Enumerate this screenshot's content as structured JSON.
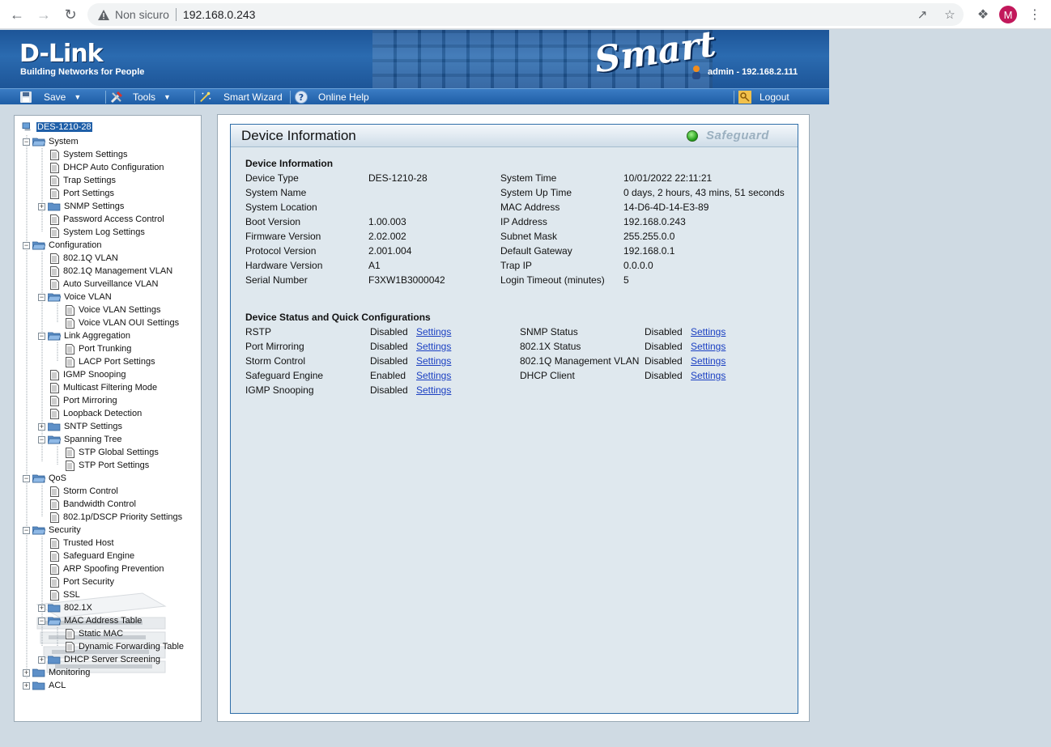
{
  "browser": {
    "security_label": "Non sicuro",
    "url": "192.168.0.243",
    "profile_initial": "M"
  },
  "banner": {
    "logo": "D-Link",
    "tagline": "Building Networks for People",
    "product": "Smart",
    "user": "admin - 192.168.2.111"
  },
  "menubar": {
    "save": "Save",
    "tools": "Tools",
    "wizard": "Smart Wizard",
    "help": "Online Help",
    "logout": "Logout"
  },
  "tree": {
    "root": "DES-1210-28",
    "system": "System",
    "system_settings": "System Settings",
    "dhcp_auto": "DHCP Auto Configuration",
    "trap": "Trap Settings",
    "port_settings": "Port Settings",
    "snmp": "SNMP Settings",
    "password": "Password Access Control",
    "syslog": "System Log Settings",
    "configuration": "Configuration",
    "vlan": "802.1Q VLAN",
    "mgmt_vlan": "802.1Q Management VLAN",
    "auto_surv": "Auto Surveillance VLAN",
    "voice_vlan": "Voice VLAN",
    "voice_vlan_settings": "Voice VLAN Settings",
    "voice_oui": "Voice VLAN OUI Settings",
    "link_agg": "Link Aggregation",
    "port_trunking": "Port Trunking",
    "lacp": "LACP Port Settings",
    "igmp": "IGMP Snooping",
    "multicast": "Multicast Filtering Mode",
    "port_mirroring": "Port Mirroring",
    "loopback": "Loopback Detection",
    "sntp": "SNTP Settings",
    "spanning": "Spanning Tree",
    "stp_global": "STP Global Settings",
    "stp_port": "STP Port Settings",
    "qos": "QoS",
    "storm": "Storm Control",
    "bandwidth": "Bandwidth Control",
    "priority": "802.1p/DSCP Priority Settings",
    "security": "Security",
    "trusted": "Trusted Host",
    "safeguard": "Safeguard Engine",
    "arp": "ARP Spoofing Prevention",
    "port_security": "Port Security",
    "ssl": "SSL",
    "dot1x": "802.1X",
    "mac_table": "MAC Address Table",
    "static_mac": "Static MAC",
    "dynamic_fwd": "Dynamic Forwarding Table",
    "dhcp_screen": "DHCP Server Screening",
    "monitoring": "Monitoring",
    "acl": "ACL"
  },
  "panel": {
    "title": "Device Information",
    "safeguard": "Safeguard",
    "info_title": "Device Information",
    "info_left": [
      {
        "label": "Device Type",
        "value": "DES-1210-28"
      },
      {
        "label": "System Name",
        "value": ""
      },
      {
        "label": "System Location",
        "value": ""
      },
      {
        "label": "Boot Version",
        "value": "1.00.003"
      },
      {
        "label": "Firmware Version",
        "value": "2.02.002"
      },
      {
        "label": "Protocol Version",
        "value": "2.001.004"
      },
      {
        "label": "Hardware Version",
        "value": "A1"
      },
      {
        "label": "Serial Number",
        "value": "F3XW1B3000042"
      }
    ],
    "info_right": [
      {
        "label": "System Time",
        "value": "10/01/2022 22:11:21"
      },
      {
        "label": "System Up Time",
        "value": "0 days, 2 hours, 43 mins, 51 seconds"
      },
      {
        "label": "MAC Address",
        "value": "14-D6-4D-14-E3-89"
      },
      {
        "label": "IP Address",
        "value": "192.168.0.243"
      },
      {
        "label": "Subnet Mask",
        "value": "255.255.0.0"
      },
      {
        "label": "Default Gateway",
        "value": "192.168.0.1"
      },
      {
        "label": "Trap IP",
        "value": "0.0.0.0"
      },
      {
        "label": "Login Timeout (minutes)",
        "value": "5"
      }
    ],
    "status_title": "Device Status and Quick Configurations",
    "settings_label": "Settings",
    "status_left": [
      {
        "label": "RSTP",
        "value": "Disabled"
      },
      {
        "label": "Port Mirroring",
        "value": "Disabled"
      },
      {
        "label": "Storm Control",
        "value": "Disabled"
      },
      {
        "label": "Safeguard Engine",
        "value": "Enabled"
      },
      {
        "label": "IGMP Snooping",
        "value": "Disabled"
      }
    ],
    "status_right": [
      {
        "label": "SNMP Status",
        "value": "Disabled"
      },
      {
        "label": "802.1X Status",
        "value": "Disabled"
      },
      {
        "label": "802.1Q Management VLAN",
        "value": "Disabled"
      },
      {
        "label": "DHCP Client",
        "value": "Disabled"
      }
    ]
  }
}
